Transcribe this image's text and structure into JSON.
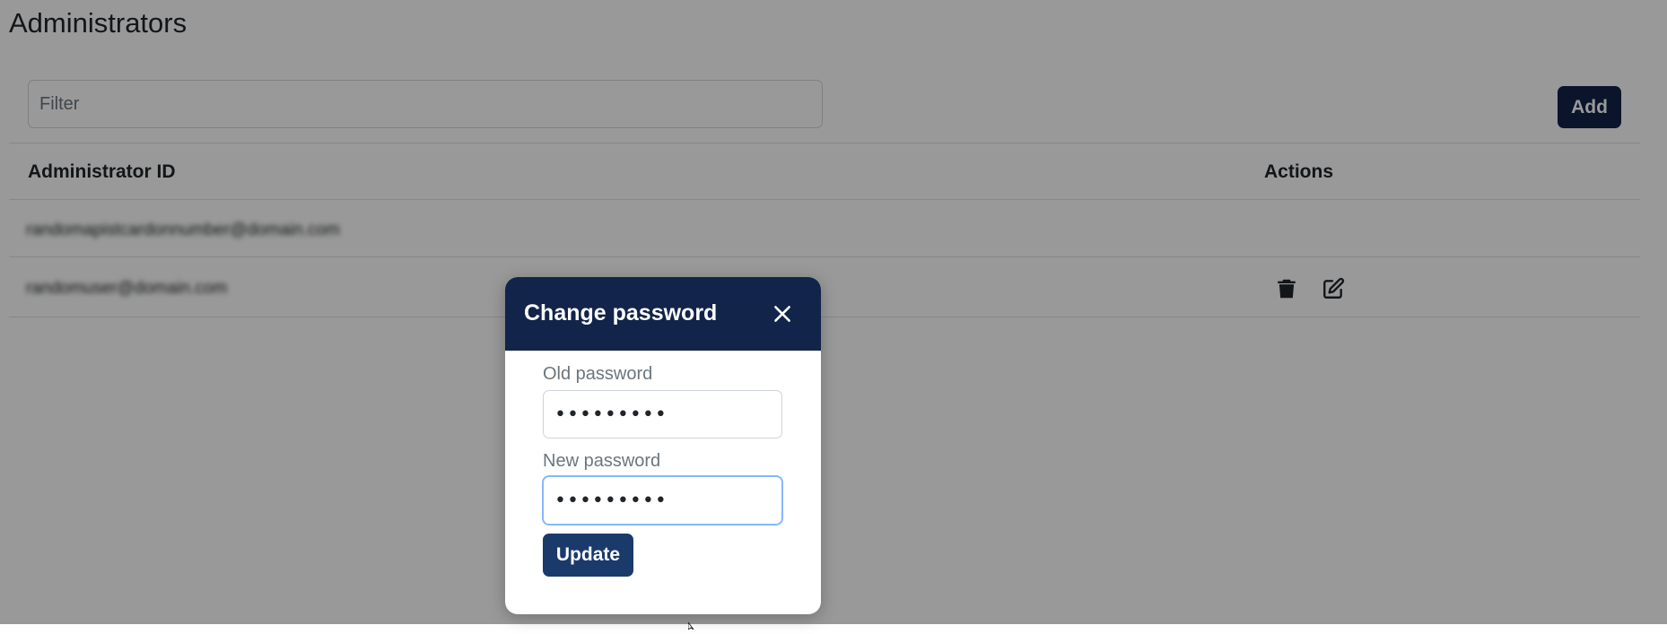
{
  "page": {
    "title": "Administrators",
    "filter_placeholder": "Filter",
    "add_label": "Add"
  },
  "table": {
    "columns": [
      "Administrator ID",
      "Actions"
    ],
    "rows": [
      {
        "id": "randomapistcardonnumber@domain.com"
      },
      {
        "id": "randomuser@domain.com"
      }
    ]
  },
  "modal": {
    "title": "Change password",
    "old_label": "Old password",
    "old_value": "•••••••••",
    "new_label": "New password",
    "new_value": "•••••••••",
    "update_label": "Update"
  },
  "icons": {
    "delete": "trash-icon",
    "edit": "edit-icon",
    "close": "close-icon"
  },
  "colors": {
    "primary": "#12244a",
    "update_button": "#1a3a6b",
    "focus_border": "#86b7fe"
  }
}
